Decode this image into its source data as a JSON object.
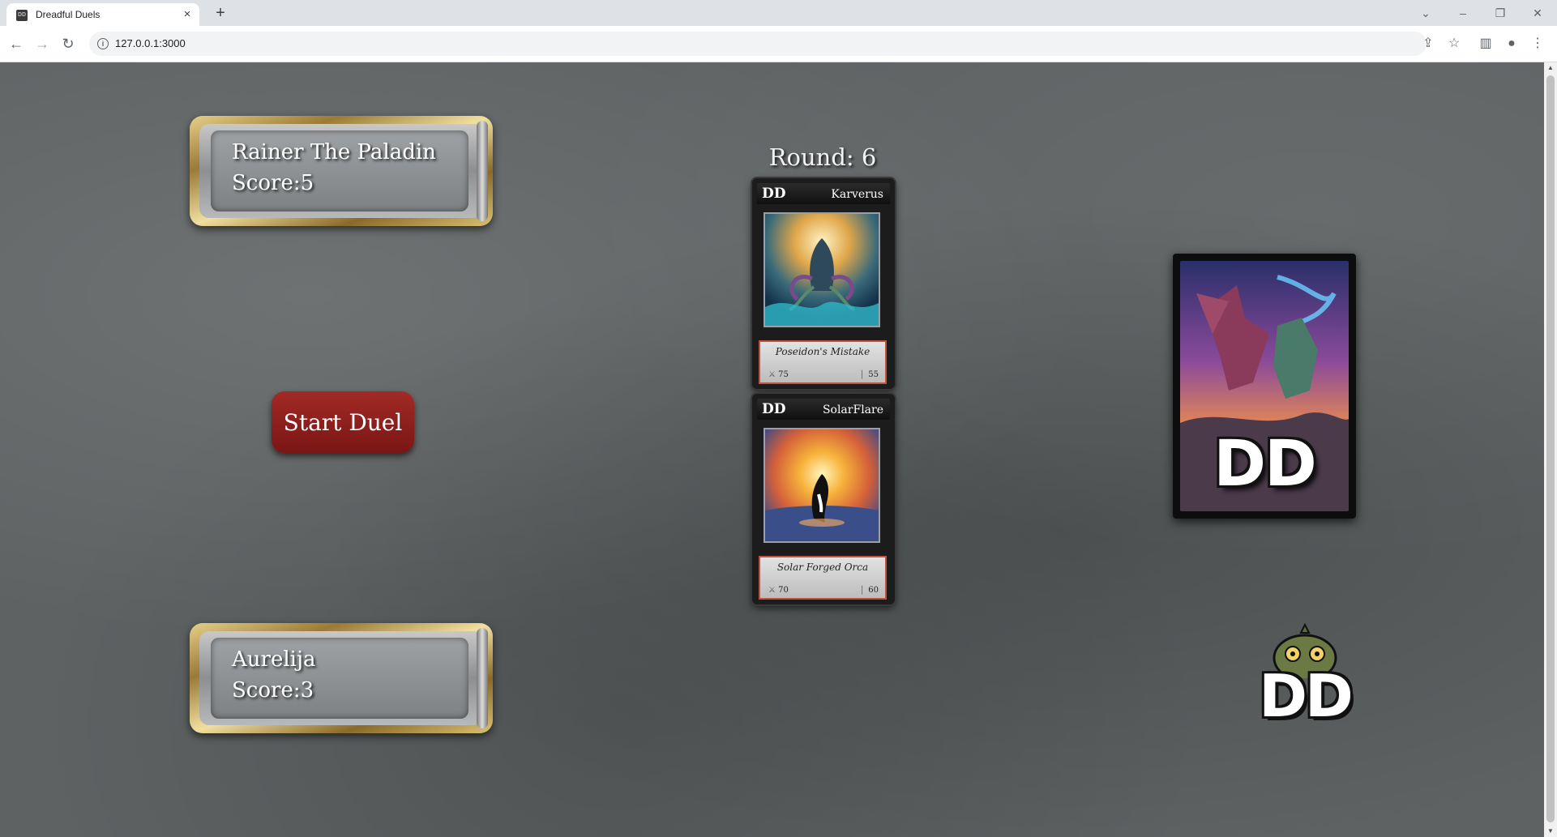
{
  "browser": {
    "tab_title": "Dreadful Duels",
    "favicon_text": "DD",
    "url": "127.0.0.1:3000"
  },
  "game": {
    "round_label": "Round: 6",
    "start_button": "Start Duel",
    "top_player": {
      "name": "Rainer The Paladin",
      "score": "Score:5"
    },
    "bottom_player": {
      "name": "Aurelija",
      "score": "Score:3"
    },
    "cards": [
      {
        "badge": "DD",
        "name": "Karverus",
        "title": "Poseidon's Mistake",
        "attack": "75",
        "mana": "55"
      },
      {
        "badge": "DD",
        "name": "SolarFlare",
        "title": "Solar Forged Orca",
        "attack": "70",
        "mana": "60"
      }
    ],
    "deck_logo": "DD",
    "mascot_logo": "DD"
  },
  "colors": {
    "start_button": "#8e1f1c",
    "frame_gold": "#c9a95a",
    "card_border": "#c0533a"
  }
}
